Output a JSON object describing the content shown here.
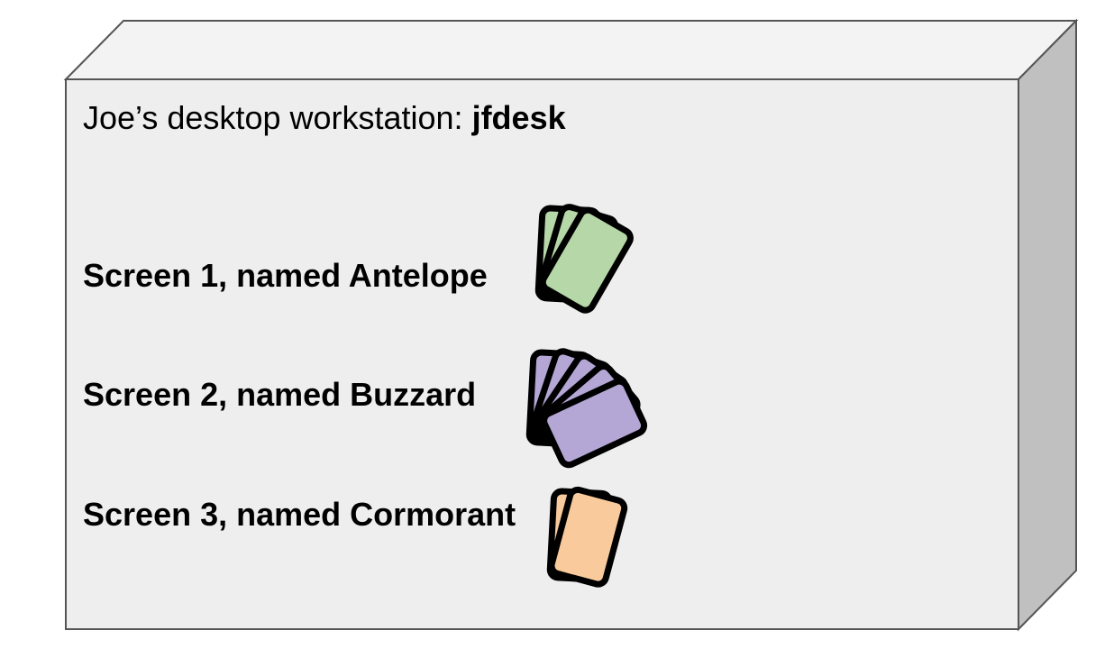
{
  "workstation": {
    "label_prefix": "Joe’s desktop workstation: ",
    "hostname": "jfdesk"
  },
  "screens": [
    {
      "label": "Screen 1, named Antelope",
      "window_count": 3,
      "color": "#b6d7a8"
    },
    {
      "label": "Screen 2, named Buzzard",
      "window_count": 5,
      "color": "#b4a7d6"
    },
    {
      "label": "Screen 3, named Cormorant",
      "window_count": 2,
      "color": "#f9cb9c"
    }
  ],
  "colors": {
    "box_front": "#eeeeee",
    "box_top": "#f3f3f3",
    "box_side": "#c0c0c0",
    "box_stroke": "#555555",
    "window_stroke": "#000000"
  }
}
